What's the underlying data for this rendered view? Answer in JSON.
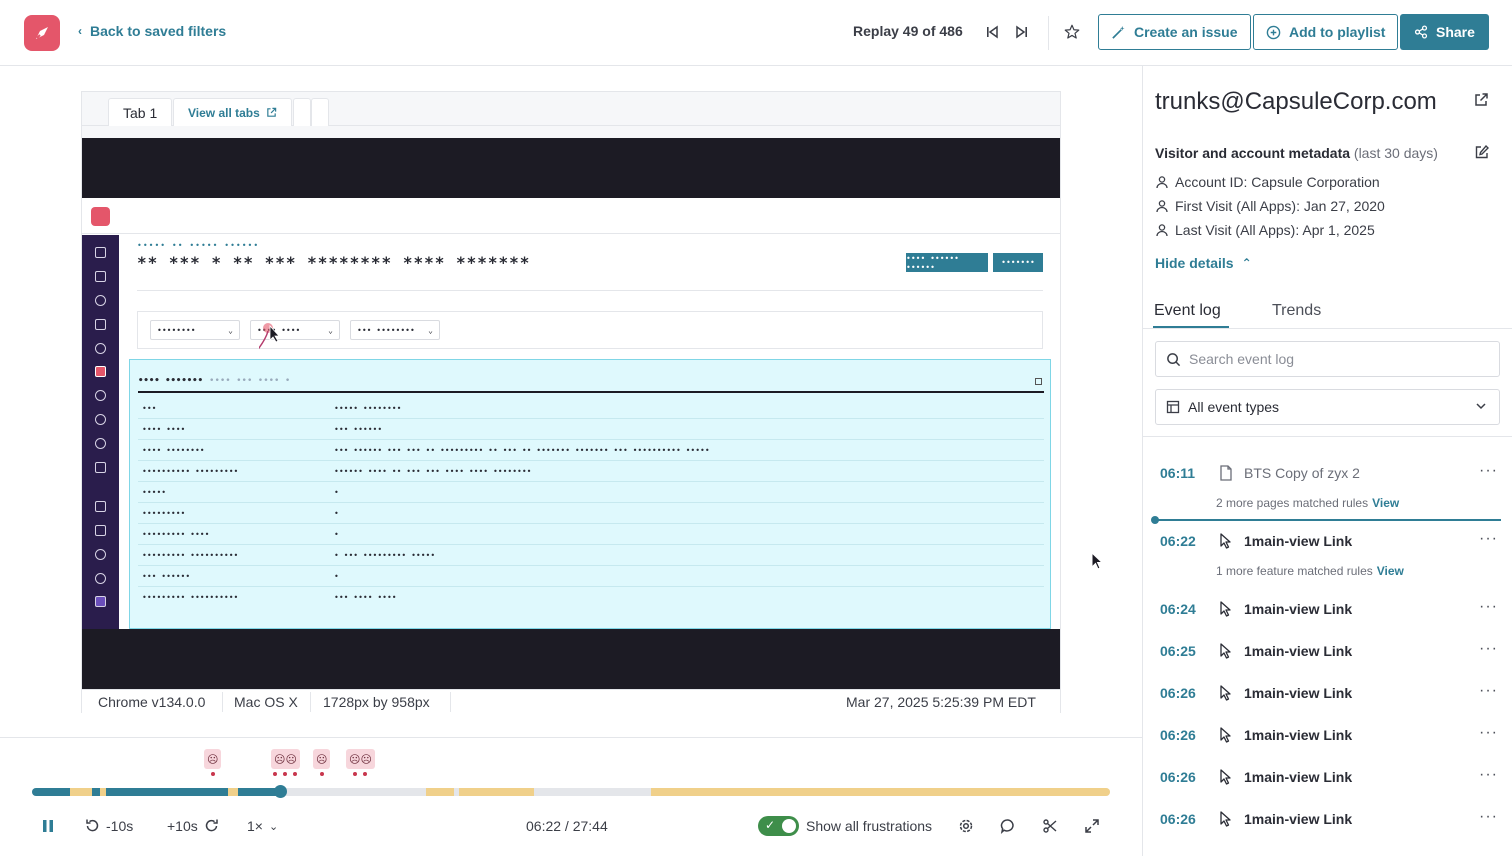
{
  "header": {
    "back_label": "Back to saved filters",
    "replay_count": "Replay 49 of 486",
    "create_issue": "Create an issue",
    "add_playlist": "Add to playlist",
    "share": "Share"
  },
  "player": {
    "tab_active": "Tab 1",
    "tab_link": "View all tabs",
    "masked": {
      "breadcrumb": "••••• •• ••••• ••••••",
      "title": "** *** * ** *** ******** **** *******",
      "btn1": "•••• •••••• ••••••",
      "btn2": "•••••••",
      "filter1": "••••••••",
      "filter2": "•••• ••••",
      "filter3": "••• ••••••••",
      "panel_title": "•••• •••••••",
      "panel_sub": "•••• ••• •••• •",
      "rows": [
        [
          "•••",
          "••••• ••••••••"
        ],
        [
          "•••• ••••",
          "••• ••••••"
        ],
        [
          "•••• ••••••••",
          "••• •••••• ••• ••• •• ••••••••• •• ••• •• ••••••• ••••••• ••• •••••••••• •••••"
        ],
        [
          "•••••••••• •••••••••",
          "•••••• •••• •• ••• ••• •••• •••• ••••••••"
        ],
        [
          "•••••",
          "•"
        ],
        [
          "•••••••••",
          "•"
        ],
        [
          "••••••••• ••••",
          "•"
        ],
        [
          "••••••••• ••••••••••",
          "• ••• ••••••••• •••••"
        ],
        [
          "••• ••••••",
          "•"
        ],
        [
          "••••••••• ••••••••••",
          "••• •••• ••••"
        ]
      ]
    },
    "status": {
      "browser": "Chrome v134.0.0",
      "os": "Mac OS X",
      "resolution": "1728px by 958px",
      "datetime": "Mar 27, 2025 5:25:39 PM EDT"
    }
  },
  "controls": {
    "rewind": "-10s",
    "forward": "+10s",
    "speed": "1×",
    "time": "06:22 / 27:44",
    "show_frustrations": "Show all frustrations",
    "progress_fraction": 0.23
  },
  "sidebar": {
    "visitor": "trunks@CapsuleCorp.com",
    "meta_heading": "Visitor and account metadata",
    "meta_range": "(last 30 days)",
    "account_id": "Account ID: Capsule Corporation",
    "first_visit": "First Visit (All Apps): Jan 27, 2020",
    "last_visit": "Last Visit (All Apps): Apr 1, 2025",
    "hide_details": "Hide details",
    "tab_event_log": "Event log",
    "tab_trends": "Trends",
    "search_placeholder": "Search event log",
    "event_filter": "All event types",
    "events": [
      {
        "time": "06:11",
        "label": "BTS Copy of zyx 2",
        "type": "page",
        "sub": "2 more pages matched rules",
        "sub_link": "View"
      },
      {
        "time": "06:22",
        "label": "1main-view Link",
        "type": "click",
        "sub": "1 more feature matched rules",
        "sub_link": "View"
      },
      {
        "time": "06:24",
        "label": "1main-view Link",
        "type": "click"
      },
      {
        "time": "06:25",
        "label": "1main-view Link",
        "type": "click"
      },
      {
        "time": "06:26",
        "label": "1main-view Link",
        "type": "click"
      },
      {
        "time": "06:26",
        "label": "1main-view Link",
        "type": "click"
      },
      {
        "time": "06:26",
        "label": "1main-view Link",
        "type": "click"
      },
      {
        "time": "06:26",
        "label": "1main-view Link",
        "type": "click"
      }
    ]
  },
  "colors": {
    "accent": "#2f7d95",
    "brand": "#e4566a",
    "frustration": "#c8364d",
    "timeline_highlight": "#f0d08a"
  }
}
